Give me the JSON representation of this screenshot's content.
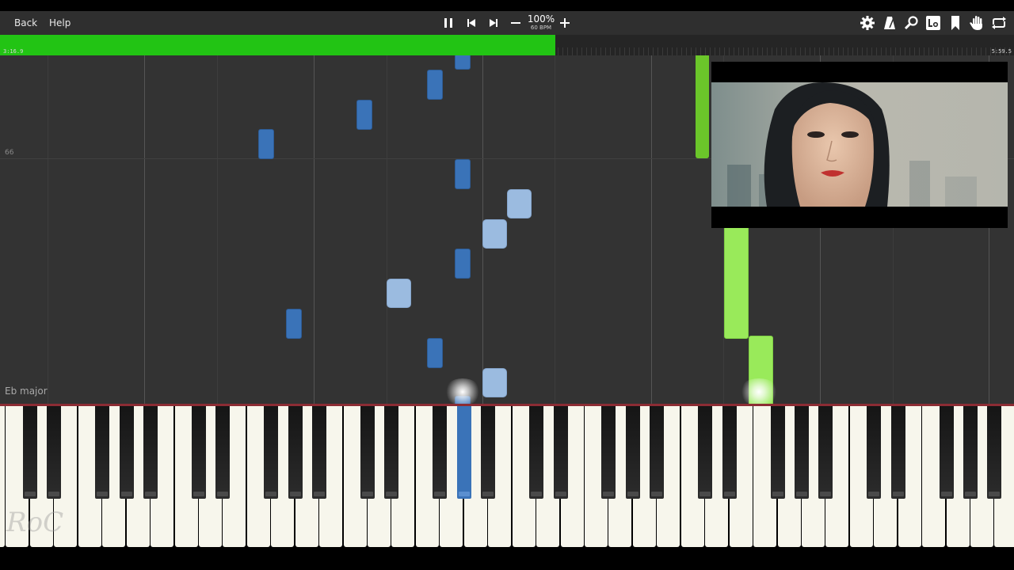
{
  "toolbar": {
    "back_label": "Back",
    "help_label": "Help",
    "zoom": "100%",
    "bpm": "60 BPM"
  },
  "progress": {
    "current_time": "3:16.9",
    "total_time": "5:59.5",
    "fraction": 0.548
  },
  "roll": {
    "measure_number": "66",
    "key_signature": "Eb major"
  },
  "watermark": "RoC",
  "colors": {
    "progress_fill": "#22c414",
    "left_hand": "#3a73b8",
    "left_hand_light": "#9bbbe0",
    "right_hand": "#99ea5a",
    "roll_bg": "#333333",
    "marker_line": "#8c2c34"
  },
  "icons": [
    "pause-icon",
    "skip-back-icon",
    "skip-forward-icon",
    "zoom-out-icon",
    "zoom-in-icon",
    "gear-icon",
    "metronome-icon",
    "search-icon",
    "label-icon",
    "bookmark-icon",
    "hand-icon",
    "loop-icon"
  ]
}
